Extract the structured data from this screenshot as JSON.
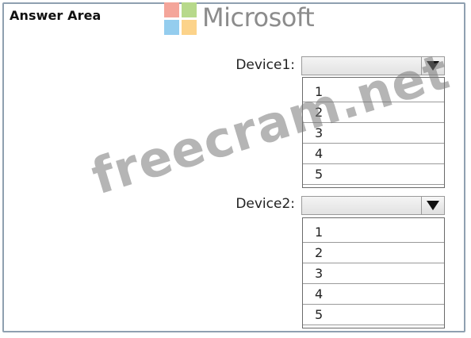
{
  "header": {
    "title": "Answer Area",
    "logo_text": "Microsoft",
    "logo_colors": [
      "#f25022",
      "#7fba00",
      "#00a4ef",
      "#ffb900"
    ]
  },
  "watermark": "freecram.net",
  "devices": [
    {
      "label": "Device1:",
      "selected": "",
      "options": [
        "1",
        "2",
        "3",
        "4",
        "5"
      ]
    },
    {
      "label": "Device2:",
      "selected": "",
      "options": [
        "1",
        "2",
        "3",
        "4",
        "5"
      ]
    }
  ]
}
